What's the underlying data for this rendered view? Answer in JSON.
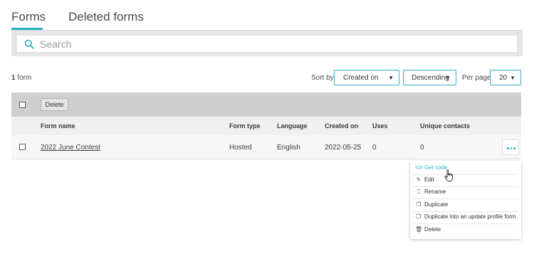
{
  "tabs": [
    {
      "label": "Forms",
      "active": true
    },
    {
      "label": "Deleted forms",
      "active": false
    }
  ],
  "search": {
    "placeholder": "Search",
    "value": ""
  },
  "summary": {
    "count": "1",
    "unit": "form"
  },
  "sort": {
    "label": "Sort by:",
    "field": "Created on",
    "order": "Descending",
    "per_page_label": "Per page:",
    "per_page": "20"
  },
  "toolbar": {
    "delete_label": "Delete"
  },
  "table": {
    "columns": [
      "Form name",
      "Form type",
      "Language",
      "Created on",
      "Uses",
      "Unique contacts"
    ],
    "rows": [
      {
        "name": "2022 June Contest",
        "type": "Hosted",
        "language": "English",
        "created": "2022-05-25",
        "uses": "0",
        "unique": "0"
      }
    ]
  },
  "menu": {
    "items": [
      {
        "label": "Get code",
        "icon": "code-icon"
      },
      {
        "label": "Edit",
        "icon": "pencil-icon"
      },
      {
        "label": "Rename",
        "icon": "rename-icon"
      },
      {
        "label": "Duplicate",
        "icon": "duplicate-icon"
      },
      {
        "label": "Duplicate into an update profile form",
        "icon": "duplicate-icon"
      },
      {
        "label": "Delete",
        "icon": "trash-icon"
      }
    ]
  },
  "colors": {
    "accent": "#2ab0c5"
  }
}
